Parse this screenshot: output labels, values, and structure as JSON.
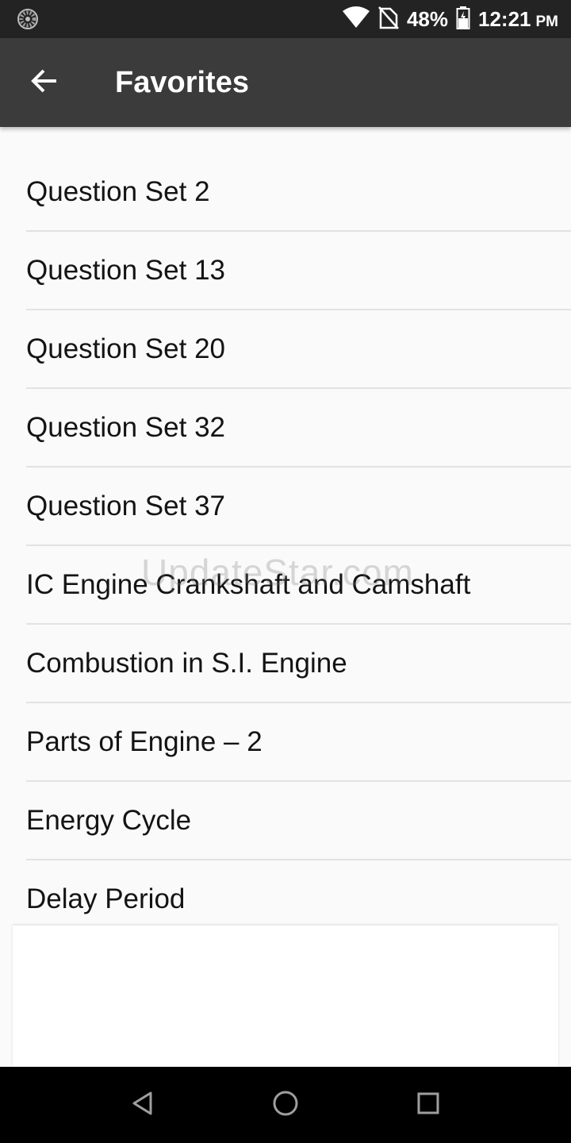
{
  "status_bar": {
    "notification_icon": "sync-loading-icon",
    "wifi_icon": "wifi-icon",
    "signal_icon": "no-sim-icon",
    "battery_percent": "48%",
    "battery_icon": "battery-icon",
    "time": "12:21",
    "ampm": "PM"
  },
  "app_bar": {
    "back_icon": "arrow-back-icon",
    "title": "Favorites"
  },
  "favorites": [
    {
      "label": "Question Set 2"
    },
    {
      "label": "Question Set 13"
    },
    {
      "label": "Question Set 20"
    },
    {
      "label": "Question Set 32"
    },
    {
      "label": "Question Set 37"
    },
    {
      "label": "IC Engine Crankshaft and Camshaft"
    },
    {
      "label": "Combustion in S.I. Engine"
    },
    {
      "label": "Parts of Engine – 2"
    },
    {
      "label": "Energy Cycle"
    },
    {
      "label": "Delay Period"
    }
  ],
  "watermark": "UpdateStar.com",
  "nav_bar": {
    "back_icon": "nav-back-icon",
    "home_icon": "nav-home-icon",
    "recents_icon": "nav-recents-icon"
  },
  "colors": {
    "status_bar": "#232323",
    "app_bar": "#3b3b3b",
    "background": "#fafafa",
    "divider": "#e2e2e2",
    "nav_bar": "#000000"
  }
}
